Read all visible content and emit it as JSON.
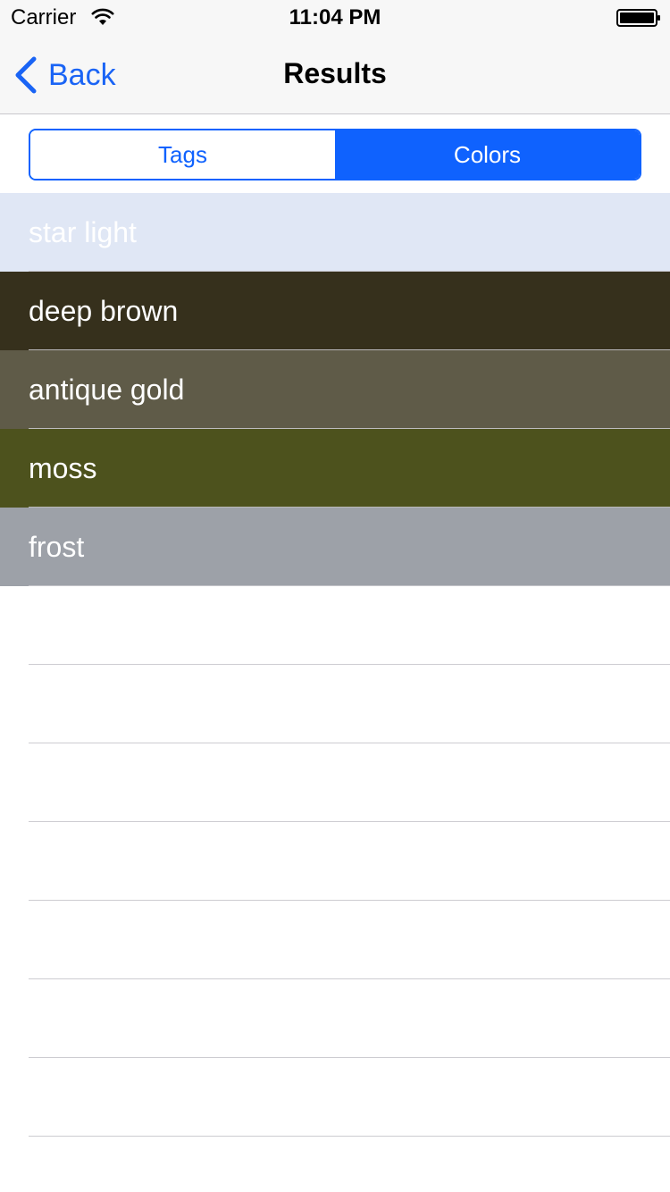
{
  "status_bar": {
    "carrier": "Carrier",
    "time": "11:04 PM",
    "wifi_icon": "wifi-icon",
    "battery_icon": "battery-icon"
  },
  "nav": {
    "back_label": "Back",
    "back_icon": "chevron-left-icon",
    "title": "Results"
  },
  "segments": [
    {
      "label": "Tags",
      "selected": false
    },
    {
      "label": "Colors",
      "selected": true
    }
  ],
  "colors": {
    "accent": "#0f62fe",
    "separator": "#c8c7cc"
  },
  "rows": [
    {
      "label": "star light",
      "color": "#e0e7f5"
    },
    {
      "label": "deep brown",
      "color": "#36301c"
    },
    {
      "label": "antique gold",
      "color": "#5f5b48"
    },
    {
      "label": "moss",
      "color": "#4d521d"
    },
    {
      "label": "frost",
      "color": "#9da1a8"
    },
    {
      "label": "",
      "color": "#ffffff"
    },
    {
      "label": "",
      "color": "#ffffff"
    },
    {
      "label": "",
      "color": "#ffffff"
    },
    {
      "label": "",
      "color": "#ffffff"
    },
    {
      "label": "",
      "color": "#ffffff"
    },
    {
      "label": "",
      "color": "#ffffff"
    },
    {
      "label": "",
      "color": "#ffffff"
    },
    {
      "label": "",
      "color": "#ffffff"
    }
  ]
}
